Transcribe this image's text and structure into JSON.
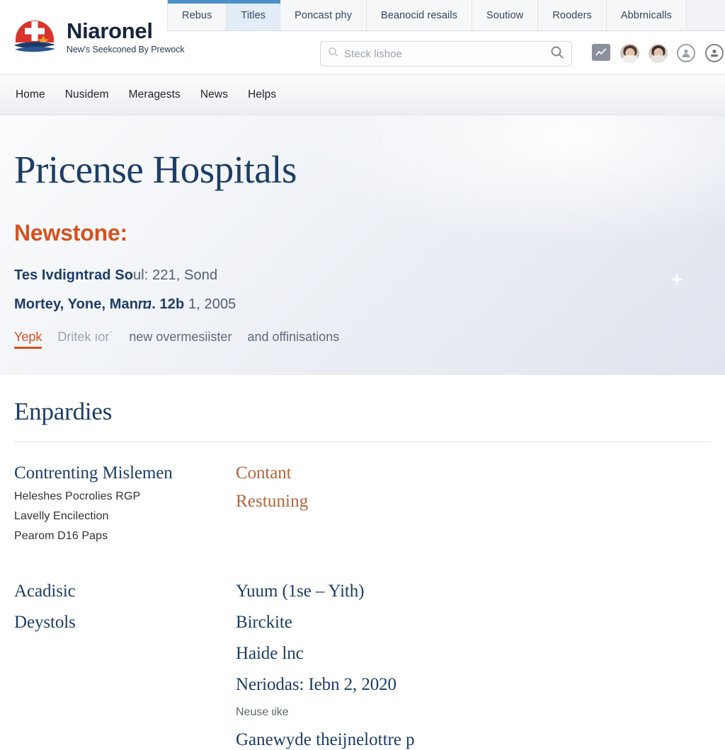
{
  "browser": {
    "tabs": [
      {
        "label": "Rebus",
        "active": false
      },
      {
        "label": "Titles",
        "active": true
      },
      {
        "label": "Poncast phy",
        "active": false
      },
      {
        "label": "Beanocid resails",
        "active": false
      },
      {
        "label": "Soutiow",
        "active": false
      },
      {
        "label": "Rooders",
        "active": false
      },
      {
        "label": "Abbrnicalls",
        "active": false
      }
    ]
  },
  "header": {
    "brand_name": "Niaronel",
    "brand_tagline": "New's Seekconed By Prewock",
    "logo_icon": "red-cross-wave-logo",
    "search": {
      "placeholder": "Steck lishoe",
      "lead_icon": "search-small-icon",
      "go_icon": "search-icon"
    },
    "icons": [
      {
        "name": "chart-tile-icon"
      },
      {
        "name": "avatar-one"
      },
      {
        "name": "avatar-two"
      },
      {
        "name": "account-circle-icon"
      },
      {
        "name": "user-badge-icon"
      }
    ]
  },
  "nav": {
    "items": [
      "Home",
      "Nusidem",
      "Meragests",
      "News",
      "Helps"
    ]
  },
  "hero": {
    "title": "Pricense Hospitals",
    "kicker": "Newstone:",
    "meta_line1_strong": "Tes Ivdigntrad So",
    "meta_line1_rest": "ul: 221, Sond",
    "meta_line2_strong": "Mortey, Yone, Manⴊ. 12b",
    "meta_line2_rest": " 1, 2005",
    "links": [
      {
        "label": "Yepk",
        "style": "active"
      },
      {
        "label": "Dritek ıor˙",
        "style": "dim"
      },
      {
        "label": "new overmesiister",
        "style": "normal"
      },
      {
        "label": "and offinisations",
        "style": "normal"
      }
    ]
  },
  "content": {
    "section_title": "Enpardies",
    "group1": {
      "left_head": "Contrenting Mislemen",
      "left_lines": [
        "Heleshes Pocrolies RGP",
        "Lavelly Encilection",
        "Pearom D16 Paps"
      ],
      "right_head": "Contant",
      "right_line": "Restuning"
    },
    "group2": {
      "left_lines": [
        "Acadisic",
        "Deystols"
      ],
      "right_lines": [
        "Yuum (1se – Yith)",
        "Birckite",
        "Haide lnc",
        "Neriodas: Iebn 2, 2020"
      ],
      "right_small": "Neuse ɩike",
      "right_clipped": "Ganewyde theijnelottre p"
    }
  },
  "colors": {
    "navy": "#1d3d66",
    "orange": "#d4521f",
    "accent_brown": "#b2653a",
    "tab_active_bar": "#4a8fc7",
    "logo_red": "#d9342b",
    "logo_navy": "#1b3a6b"
  }
}
